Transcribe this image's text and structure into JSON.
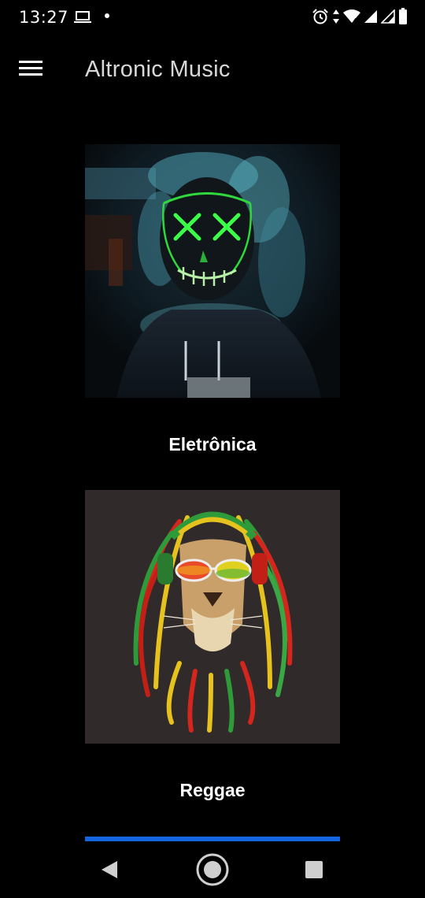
{
  "status_bar": {
    "time": "13:27",
    "icons": [
      "laptop-icon",
      "notification-dot",
      "alarm-icon",
      "data-arrows-icon",
      "wifi-icon",
      "signal-icon",
      "signal-icon-2",
      "battery-icon"
    ]
  },
  "app_bar": {
    "title": "Altronic Music",
    "menu_icon": "hamburger-menu-icon"
  },
  "genres": [
    {
      "label": "Eletrônica",
      "image": "neon-mask-smoke-photo"
    },
    {
      "label": "Reggae",
      "image": "rasta-lion-illustration"
    }
  ],
  "colors": {
    "background": "#000000",
    "accent": "#1565e0",
    "text": "#ffffff",
    "title": "#d8d8d8"
  },
  "nav_bar": {
    "icons": [
      "back-icon",
      "home-icon",
      "recents-icon"
    ]
  }
}
